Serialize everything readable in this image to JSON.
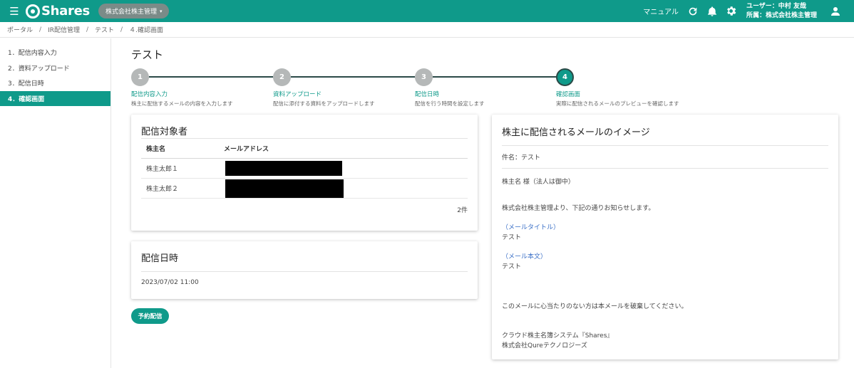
{
  "header": {
    "logo_text": "Shares",
    "company_button": "株式会社株主管理",
    "manual": "マニュアル",
    "user_line": "ユーザー：中村 友哉",
    "affiliation_line": "所属：株式会社株主管理"
  },
  "breadcrumb": [
    "ポータル",
    "IR配信管理",
    "テスト",
    "４.確認画面"
  ],
  "sidebar": {
    "items": [
      {
        "label": "1．配信内容入力",
        "active": false
      },
      {
        "label": "2．資料アップロード",
        "active": false
      },
      {
        "label": "3．配信日時",
        "active": false
      },
      {
        "label": "4．確認画面",
        "active": true
      }
    ]
  },
  "page_title": "テスト",
  "stepper": {
    "steps": [
      {
        "num": "1",
        "title": "配信内容入力",
        "desc": "株主に配信するメールの内容を入力します",
        "active": false
      },
      {
        "num": "2",
        "title": "資料アップロード",
        "desc": "配信に添付する資料をアップロードします",
        "active": false
      },
      {
        "num": "3",
        "title": "配信日時",
        "desc": "配信を行う時間を設定します",
        "active": false
      },
      {
        "num": "4",
        "title": "確認画面",
        "desc": "実際に配信されるメールのプレビューを確認します",
        "active": true
      }
    ]
  },
  "recipients": {
    "title": "配信対象者",
    "col_name": "株主名",
    "col_mail": "メールアドレス",
    "rows": [
      {
        "name": "株主太郎１"
      },
      {
        "name": "株主太郎２"
      }
    ],
    "count": "2件"
  },
  "delivery": {
    "title": "配信日時",
    "value": "2023/07/02 11:00"
  },
  "reserve_button": "予約配信",
  "preview": {
    "title": "株主に配信されるメールのイメージ",
    "subject": "件名：テスト",
    "salutation": "株主名 様（法人は御中）",
    "intro": "株式会社株主管理より、下記の通りお知らせします。",
    "mail_title_label": "（メールタイトル）",
    "mail_title_value": "テスト",
    "mail_body_label": "（メール本文）",
    "mail_body_value": "テスト",
    "disclaimer": "このメールに心当たりのない方は本メールを破棄してください。",
    "sign1": "クラウド株主名簿システム『Shares』",
    "sign2": "株式会社Qureテクノロジーズ"
  },
  "colors": {
    "brand": "#0f9a8a",
    "link": "#3a6fc7"
  }
}
